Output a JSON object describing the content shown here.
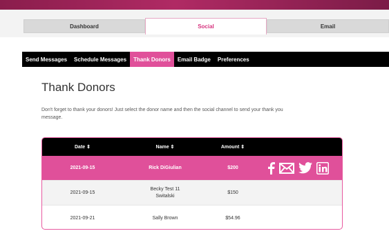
{
  "main_tabs": [
    {
      "label": "Dashboard"
    },
    {
      "label": "Social"
    },
    {
      "label": "Email"
    }
  ],
  "sub_nav": [
    {
      "label": "Send Messages"
    },
    {
      "label": "Schedule Messages"
    },
    {
      "label": "Thank Donors"
    },
    {
      "label": "Email Badge"
    },
    {
      "label": "Preferences"
    }
  ],
  "page_title": "Thank Donors",
  "description": "Don't forget to thank your donors! Just select the donor name and then the social channel to send your thank you message.",
  "table": {
    "columns": [
      {
        "label": "Date ⇕"
      },
      {
        "label": "Name ⇕"
      },
      {
        "label": "Amount ⇕"
      }
    ],
    "rows": [
      {
        "date": "2021-09-15",
        "name": "Rick DiGiulian",
        "amount": "$200"
      },
      {
        "date": "2021-09-15",
        "name": "Becky Test 11 Switalski",
        "amount": "$150"
      },
      {
        "date": "2021-09-21",
        "name": "Sally Brown",
        "amount": "$54.96"
      }
    ]
  },
  "social_icons": [
    "facebook-icon",
    "email-icon",
    "twitter-icon",
    "linkedin-icon"
  ],
  "colors": {
    "accent": "#e0509a",
    "header_band": "#8a1d4c",
    "nav_bg": "#000000"
  }
}
